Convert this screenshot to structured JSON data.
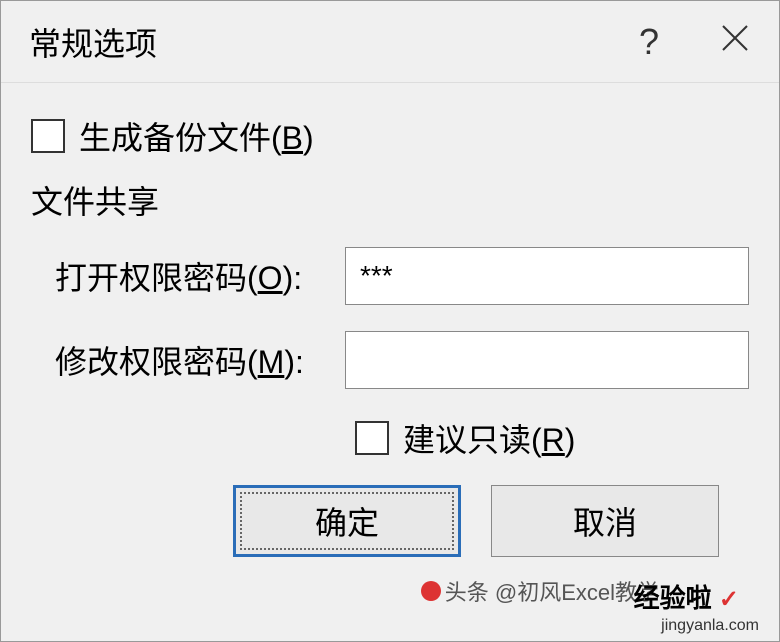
{
  "dialog": {
    "title": "常规选项",
    "backup_checkbox_label": "生成备份文件(",
    "backup_checkbox_key": "B",
    "backup_checkbox_label_end": ")",
    "section_label": "文件共享",
    "open_password_label": "打开权限密码(",
    "open_password_key": "O",
    "open_password_label_end": "):",
    "open_password_value": "***",
    "modify_password_label": "修改权限密码(",
    "modify_password_key": "M",
    "modify_password_label_end": "):",
    "modify_password_value": "",
    "readonly_checkbox_label": "建议只读(",
    "readonly_checkbox_key": "R",
    "readonly_checkbox_label_end": ")",
    "ok_button": "确定",
    "cancel_button": "取消"
  },
  "watermark": {
    "text1": "头条 @初风Excel教学",
    "text2": "经验啦",
    "text3": "jingyanla.com"
  }
}
